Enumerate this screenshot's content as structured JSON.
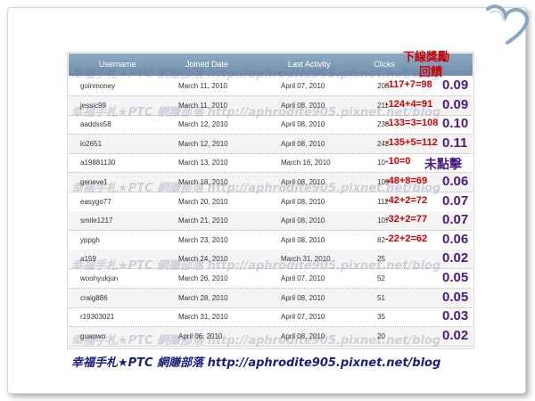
{
  "table": {
    "columns": [
      "Username",
      "Joined Date",
      "Last Activity",
      "Clicks"
    ],
    "rows": [
      {
        "username": "goinmoney",
        "joined": "March 11, 2010",
        "last": "April 07, 2010",
        "clicks": "208",
        "formula": "117+7=98",
        "reward": "0.09"
      },
      {
        "username": "jessic99",
        "joined": "March 11, 2010",
        "last": "April 08, 2010",
        "clicks": "211",
        "formula": "124+4=91",
        "reward": "0.09"
      },
      {
        "username": "aaddss58",
        "joined": "March 12, 2010",
        "last": "April 08, 2010",
        "clicks": "238",
        "formula": "133=3=108",
        "reward": "0.10"
      },
      {
        "username": "lo2651",
        "joined": "March 12, 2010",
        "last": "April 08, 2010",
        "clicks": "242",
        "formula": "135+5=112",
        "reward": "0.11"
      },
      {
        "username": "a19881130",
        "joined": "March 13, 2010",
        "last": "March 16, 2010",
        "clicks": "10",
        "formula": "10=0",
        "reward": "未點擊"
      },
      {
        "username": "geneve1",
        "joined": "March 18, 2010",
        "last": "April 08, 2010",
        "clicks": "109",
        "formula": "48+8=69",
        "reward": "0.06"
      },
      {
        "username": "easygo77",
        "joined": "March 20, 2010",
        "last": "April 08, 2010",
        "clicks": "112",
        "formula": "42+2=72",
        "reward": "0.07"
      },
      {
        "username": "smile1217",
        "joined": "March 21, 2010",
        "last": "April 08, 2010",
        "clicks": "107",
        "formula": "32+2=77",
        "reward": "0.07"
      },
      {
        "username": "yppgh",
        "joined": "March 23, 2010",
        "last": "April 08, 2010",
        "clicks": "82",
        "formula": "22+2=62",
        "reward": "0.06"
      },
      {
        "username": "a159",
        "joined": "March 24, 2010",
        "last": "March 31, 2010",
        "clicks": "25",
        "formula": "",
        "reward": "0.02"
      },
      {
        "username": "woohyukjun",
        "joined": "March 26, 2010",
        "last": "April 07, 2010",
        "clicks": "52",
        "formula": "",
        "reward": "0.05"
      },
      {
        "username": "craig886",
        "joined": "March 28, 2010",
        "last": "April 08, 2010",
        "clicks": "51",
        "formula": "",
        "reward": "0.05"
      },
      {
        "username": "r19303021",
        "joined": "March 31, 2010",
        "last": "April 07, 2010",
        "clicks": "35",
        "formula": "",
        "reward": "0.03"
      },
      {
        "username": "guaowo",
        "joined": "April 06, 2010",
        "last": "April 08, 2010",
        "clicks": "20",
        "formula": "",
        "reward": "0.02"
      }
    ]
  },
  "annotation": {
    "header_line1": "下線獎勵",
    "header_line2": "回饋"
  },
  "watermark_text": "幸福手札★PTC 網賺部落 http://aphrodite905.pixnet.net/blog",
  "footer_text": "幸福手札★PTC 網賺部落 http://aphrodite905.pixnet.net/blog",
  "colors": {
    "header_bg": "#7d9bb8",
    "formula": "#cc0000",
    "reward": "#4b1a86",
    "footer": "#1b1f7a"
  }
}
